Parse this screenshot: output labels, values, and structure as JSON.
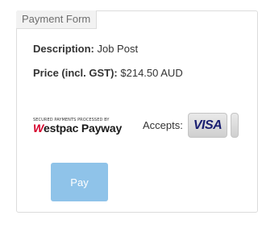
{
  "form": {
    "tab_label": "Payment Form",
    "description_label": "Description:",
    "description_value": "Job Post",
    "price_label": "Price (incl. GST):",
    "price_value": "$214.50 AUD",
    "accepts_label": "Accepts:",
    "pay_label": "Pay"
  },
  "westpac": {
    "secured_text": "SECURED PAYMENTS PROCESSED BY",
    "brand_w": "W",
    "brand_rest": "estpac Payway"
  },
  "cards": {
    "visa_label": "VISA"
  },
  "colors": {
    "pay_button": "#8fc3e9",
    "westpac_red": "#d5002b",
    "visa_blue": "#1a1f71"
  }
}
